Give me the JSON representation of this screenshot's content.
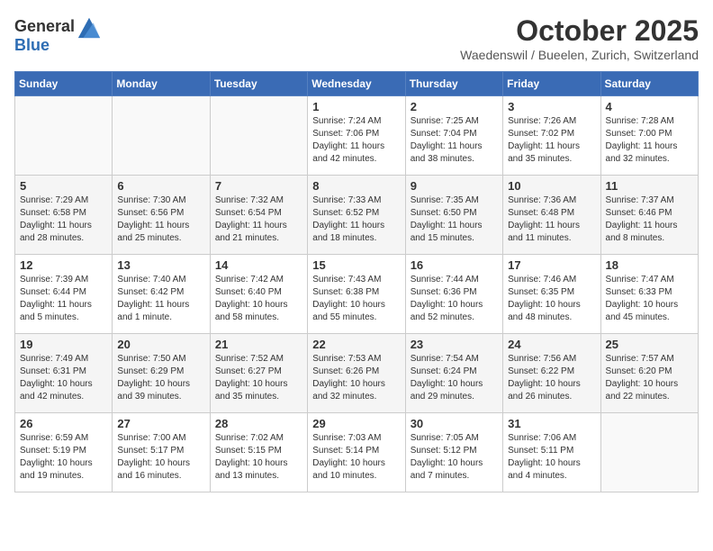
{
  "header": {
    "logo_general": "General",
    "logo_blue": "Blue",
    "month_title": "October 2025",
    "subtitle": "Waedenswil / Bueelen, Zurich, Switzerland"
  },
  "weekdays": [
    "Sunday",
    "Monday",
    "Tuesday",
    "Wednesday",
    "Thursday",
    "Friday",
    "Saturday"
  ],
  "weeks": [
    [
      {
        "day": "",
        "info": ""
      },
      {
        "day": "",
        "info": ""
      },
      {
        "day": "",
        "info": ""
      },
      {
        "day": "1",
        "info": "Sunrise: 7:24 AM\nSunset: 7:06 PM\nDaylight: 11 hours\nand 42 minutes."
      },
      {
        "day": "2",
        "info": "Sunrise: 7:25 AM\nSunset: 7:04 PM\nDaylight: 11 hours\nand 38 minutes."
      },
      {
        "day": "3",
        "info": "Sunrise: 7:26 AM\nSunset: 7:02 PM\nDaylight: 11 hours\nand 35 minutes."
      },
      {
        "day": "4",
        "info": "Sunrise: 7:28 AM\nSunset: 7:00 PM\nDaylight: 11 hours\nand 32 minutes."
      }
    ],
    [
      {
        "day": "5",
        "info": "Sunrise: 7:29 AM\nSunset: 6:58 PM\nDaylight: 11 hours\nand 28 minutes."
      },
      {
        "day": "6",
        "info": "Sunrise: 7:30 AM\nSunset: 6:56 PM\nDaylight: 11 hours\nand 25 minutes."
      },
      {
        "day": "7",
        "info": "Sunrise: 7:32 AM\nSunset: 6:54 PM\nDaylight: 11 hours\nand 21 minutes."
      },
      {
        "day": "8",
        "info": "Sunrise: 7:33 AM\nSunset: 6:52 PM\nDaylight: 11 hours\nand 18 minutes."
      },
      {
        "day": "9",
        "info": "Sunrise: 7:35 AM\nSunset: 6:50 PM\nDaylight: 11 hours\nand 15 minutes."
      },
      {
        "day": "10",
        "info": "Sunrise: 7:36 AM\nSunset: 6:48 PM\nDaylight: 11 hours\nand 11 minutes."
      },
      {
        "day": "11",
        "info": "Sunrise: 7:37 AM\nSunset: 6:46 PM\nDaylight: 11 hours\nand 8 minutes."
      }
    ],
    [
      {
        "day": "12",
        "info": "Sunrise: 7:39 AM\nSunset: 6:44 PM\nDaylight: 11 hours\nand 5 minutes."
      },
      {
        "day": "13",
        "info": "Sunrise: 7:40 AM\nSunset: 6:42 PM\nDaylight: 11 hours\nand 1 minute."
      },
      {
        "day": "14",
        "info": "Sunrise: 7:42 AM\nSunset: 6:40 PM\nDaylight: 10 hours\nand 58 minutes."
      },
      {
        "day": "15",
        "info": "Sunrise: 7:43 AM\nSunset: 6:38 PM\nDaylight: 10 hours\nand 55 minutes."
      },
      {
        "day": "16",
        "info": "Sunrise: 7:44 AM\nSunset: 6:36 PM\nDaylight: 10 hours\nand 52 minutes."
      },
      {
        "day": "17",
        "info": "Sunrise: 7:46 AM\nSunset: 6:35 PM\nDaylight: 10 hours\nand 48 minutes."
      },
      {
        "day": "18",
        "info": "Sunrise: 7:47 AM\nSunset: 6:33 PM\nDaylight: 10 hours\nand 45 minutes."
      }
    ],
    [
      {
        "day": "19",
        "info": "Sunrise: 7:49 AM\nSunset: 6:31 PM\nDaylight: 10 hours\nand 42 minutes."
      },
      {
        "day": "20",
        "info": "Sunrise: 7:50 AM\nSunset: 6:29 PM\nDaylight: 10 hours\nand 39 minutes."
      },
      {
        "day": "21",
        "info": "Sunrise: 7:52 AM\nSunset: 6:27 PM\nDaylight: 10 hours\nand 35 minutes."
      },
      {
        "day": "22",
        "info": "Sunrise: 7:53 AM\nSunset: 6:26 PM\nDaylight: 10 hours\nand 32 minutes."
      },
      {
        "day": "23",
        "info": "Sunrise: 7:54 AM\nSunset: 6:24 PM\nDaylight: 10 hours\nand 29 minutes."
      },
      {
        "day": "24",
        "info": "Sunrise: 7:56 AM\nSunset: 6:22 PM\nDaylight: 10 hours\nand 26 minutes."
      },
      {
        "day": "25",
        "info": "Sunrise: 7:57 AM\nSunset: 6:20 PM\nDaylight: 10 hours\nand 22 minutes."
      }
    ],
    [
      {
        "day": "26",
        "info": "Sunrise: 6:59 AM\nSunset: 5:19 PM\nDaylight: 10 hours\nand 19 minutes."
      },
      {
        "day": "27",
        "info": "Sunrise: 7:00 AM\nSunset: 5:17 PM\nDaylight: 10 hours\nand 16 minutes."
      },
      {
        "day": "28",
        "info": "Sunrise: 7:02 AM\nSunset: 5:15 PM\nDaylight: 10 hours\nand 13 minutes."
      },
      {
        "day": "29",
        "info": "Sunrise: 7:03 AM\nSunset: 5:14 PM\nDaylight: 10 hours\nand 10 minutes."
      },
      {
        "day": "30",
        "info": "Sunrise: 7:05 AM\nSunset: 5:12 PM\nDaylight: 10 hours\nand 7 minutes."
      },
      {
        "day": "31",
        "info": "Sunrise: 7:06 AM\nSunset: 5:11 PM\nDaylight: 10 hours\nand 4 minutes."
      },
      {
        "day": "",
        "info": ""
      }
    ]
  ]
}
